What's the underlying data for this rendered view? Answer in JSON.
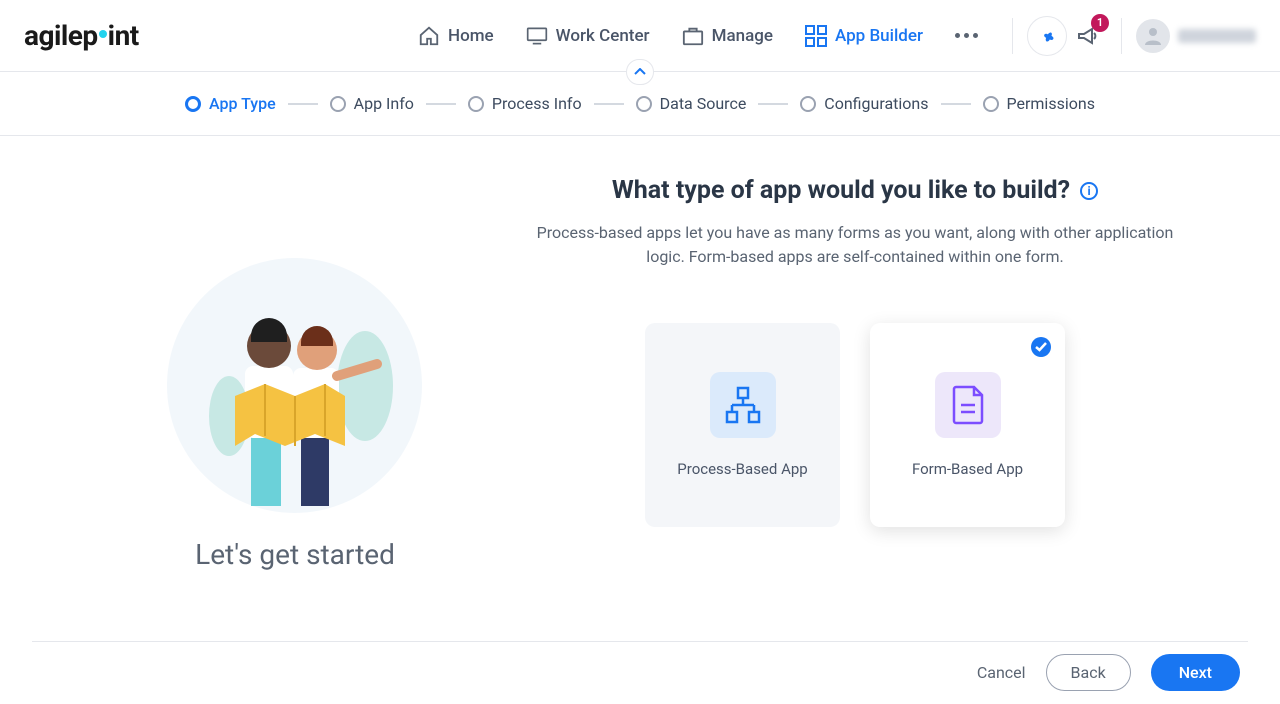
{
  "brand": "agilepoint",
  "nav": {
    "items": [
      {
        "label": "Home",
        "active": false
      },
      {
        "label": "Work Center",
        "active": false
      },
      {
        "label": "Manage",
        "active": false
      },
      {
        "label": "App Builder",
        "active": true
      }
    ],
    "notification_count": "1"
  },
  "steps": [
    {
      "label": "App Type",
      "active": true
    },
    {
      "label": "App Info",
      "active": false
    },
    {
      "label": "Process Info",
      "active": false
    },
    {
      "label": "Data Source",
      "active": false
    },
    {
      "label": "Configurations",
      "active": false
    },
    {
      "label": "Permissions",
      "active": false
    }
  ],
  "left": {
    "subtitle": "Let's get started"
  },
  "main": {
    "question": "What type of app would you like to build?",
    "desc": "Process-based apps let you have as many forms as you want, along with other application logic. Form-based apps are self-contained within one form.",
    "cards": [
      {
        "label": "Process-Based App",
        "selected": false
      },
      {
        "label": "Form-Based App",
        "selected": true
      }
    ]
  },
  "footer": {
    "cancel": "Cancel",
    "back": "Back",
    "next": "Next"
  }
}
